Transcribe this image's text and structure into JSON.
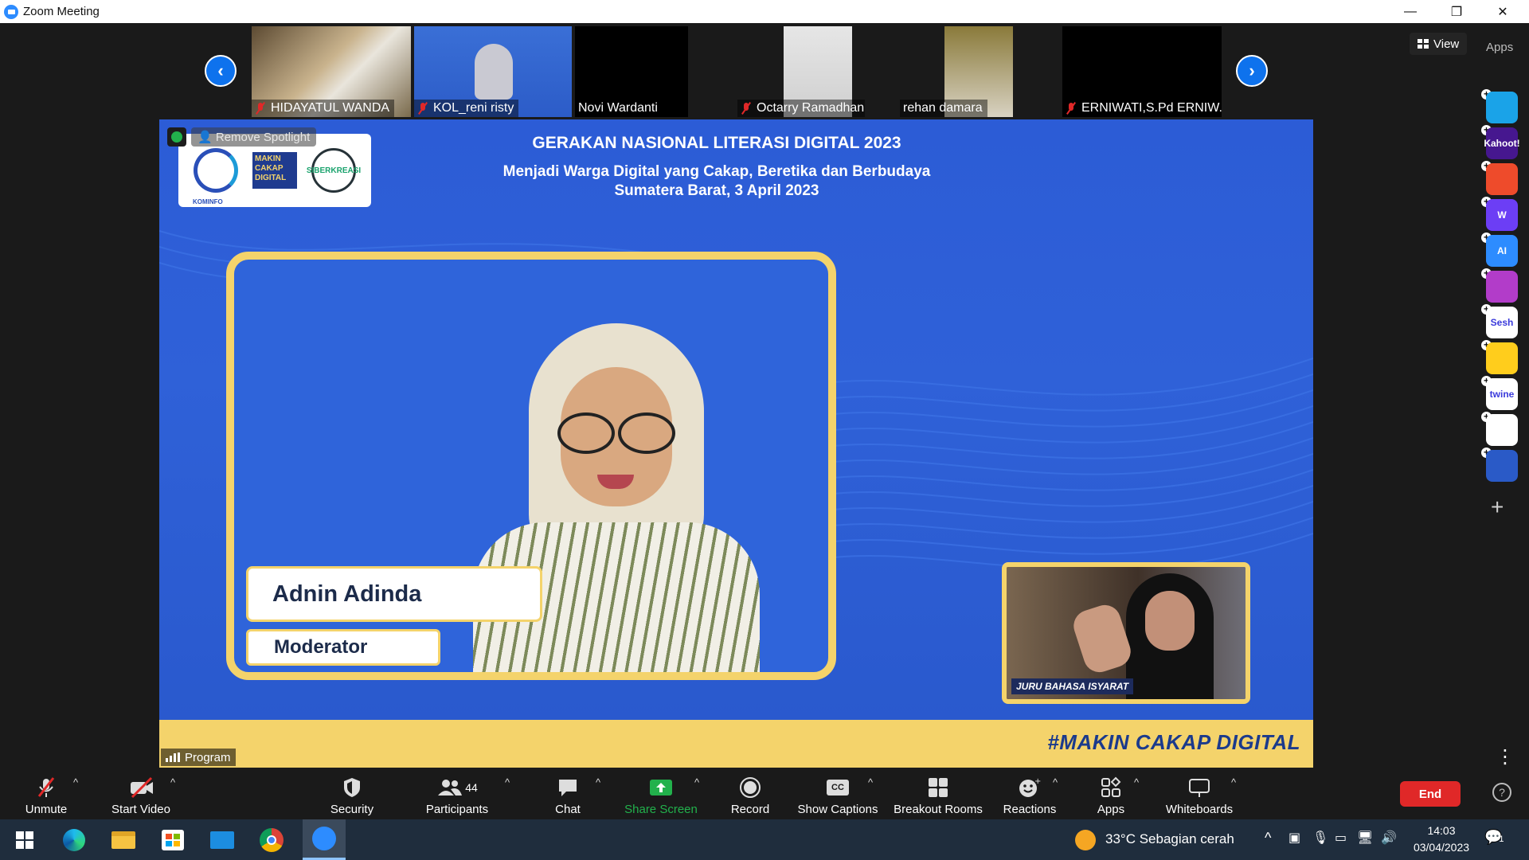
{
  "window": {
    "title": "Zoom Meeting",
    "minimize": "—",
    "restore": "❐",
    "close": "✕"
  },
  "participants_strip": [
    {
      "name": "HIDAYATUL WANDA",
      "muted": true
    },
    {
      "name": "KOL_reni risty",
      "muted": true
    },
    {
      "name": "Novi Wardanti",
      "muted": false
    },
    {
      "name": "Octarry Ramadhani",
      "muted": true
    },
    {
      "name": "rehan damara",
      "muted": false
    },
    {
      "name": "ERNIWATI,S.Pd ERNIW...",
      "muted": true
    }
  ],
  "spotlight": {
    "remove_label": "Remove Spotlight"
  },
  "stage": {
    "headline": "GERAKAN NASIONAL LITERASI DIGITAL 2023",
    "subline1": "Menjadi Warga Digital yang Cakap, Beretika dan Berbudaya",
    "subline2": "Sumatera Barat, 3 April 2023",
    "logo_makin": "MAKIN CAKAP DIGITAL",
    "logo_kominfo": "KOMINFO",
    "logo_siber": "SIBERKREASI",
    "speaker_name": "Adnin Adinda",
    "speaker_role": "Moderator",
    "pip_label": "JURU BAHASA ISYARAT",
    "hashtag": "#MAKIN CAKAP DIGITAL",
    "program_label": "Program"
  },
  "right_panel": {
    "view_label": "View",
    "apps_label": "Apps",
    "apps": [
      {
        "name": "arrow-app",
        "color": "#1aa3e8",
        "text": ""
      },
      {
        "name": "kahoot",
        "color": "#46178f",
        "text": "Kahoot!"
      },
      {
        "name": "app-red",
        "color": "#ee4b2b",
        "text": ""
      },
      {
        "name": "wooclap",
        "color": "#6c3ef5",
        "text": "W"
      },
      {
        "name": "ai-companion",
        "color": "#2d8cff",
        "text": "AI"
      },
      {
        "name": "purple-app",
        "color": "#b23cc9",
        "text": ""
      },
      {
        "name": "sesh",
        "color": "#ffffff",
        "text": "Sesh"
      },
      {
        "name": "emoji-app",
        "color": "#ffcd1c",
        "text": ""
      },
      {
        "name": "twine",
        "color": "#ffffff",
        "text": "twine"
      },
      {
        "name": "blocks-app",
        "color": "#ffffff",
        "text": ""
      },
      {
        "name": "sync-app",
        "color": "#2a5ac7",
        "text": ""
      }
    ]
  },
  "toolbar": {
    "unmute": "Unmute",
    "start_video": "Start Video",
    "security": "Security",
    "participants": "Participants",
    "participants_count": "44",
    "chat": "Chat",
    "share_screen": "Share Screen",
    "record": "Record",
    "show_captions": "Show Captions",
    "breakout_rooms": "Breakout Rooms",
    "reactions": "Reactions",
    "apps": "Apps",
    "whiteboards": "Whiteboards",
    "end": "End",
    "cc": "CC"
  },
  "taskbar": {
    "weather": "33°C  Sebagian cerah",
    "time": "14:03",
    "date": "03/04/2023",
    "notification_count": "1"
  },
  "colors": {
    "zoom_blue": "#0e72ed",
    "end_red": "#e02828",
    "share_green": "#22b14c",
    "stage_yellow": "#f4d36b"
  }
}
